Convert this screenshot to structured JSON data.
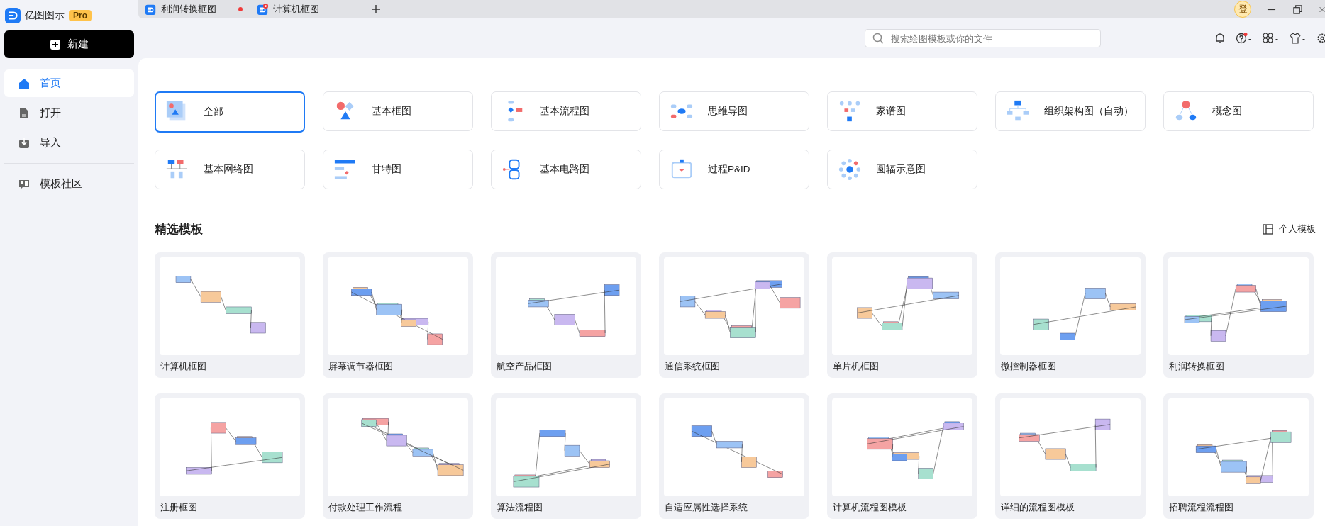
{
  "app": {
    "name": "亿图图示",
    "badge": "Pro"
  },
  "tabs": [
    {
      "title": "利润转换框图",
      "unsaved": true,
      "icon_badge": false
    },
    {
      "title": "计算机框图",
      "unsaved": false,
      "icon_badge": true
    }
  ],
  "user": {
    "avatar": "登"
  },
  "new_button": "新建",
  "sidebar": {
    "items": [
      {
        "label": "首页",
        "selected": true
      },
      {
        "label": "打开",
        "selected": false
      },
      {
        "label": "导入",
        "selected": false
      }
    ],
    "community": {
      "label": "模板社区",
      "selected": false
    }
  },
  "search": {
    "placeholder": "搜索绘图模板或你的文件"
  },
  "toolbar": {
    "help_badge": true
  },
  "categories": [
    {
      "label": "全部",
      "selected": true
    },
    {
      "label": "基本框图",
      "selected": false
    },
    {
      "label": "基本流程图",
      "selected": false
    },
    {
      "label": "思维导图",
      "selected": false
    },
    {
      "label": "家谱图",
      "selected": false
    },
    {
      "label": "组织架构图（自动）",
      "selected": false
    },
    {
      "label": "概念图",
      "selected": false
    },
    {
      "label": "基本网络图",
      "selected": false
    },
    {
      "label": "甘特图",
      "selected": false
    },
    {
      "label": "基本电路图",
      "selected": false
    },
    {
      "label": "过程P&ID",
      "selected": false
    },
    {
      "label": "圆辐示意图",
      "selected": false
    }
  ],
  "featured": {
    "title": "精选模板",
    "personal_link": "个人模板",
    "templates": [
      {
        "title": "计算机框图"
      },
      {
        "title": "屏幕调节器框图"
      },
      {
        "title": "航空产品框图"
      },
      {
        "title": "通信系统框图"
      },
      {
        "title": "单片机框图"
      },
      {
        "title": "微控制器框图"
      },
      {
        "title": "利润转换框图"
      },
      {
        "title": "注册框图"
      },
      {
        "title": "付款处理工作流程"
      },
      {
        "title": "算法流程图"
      },
      {
        "title": "自适应属性选择系统"
      },
      {
        "title": "计算机流程图模板"
      },
      {
        "title": "详细的流程图模板"
      },
      {
        "title": "招聘流程流程图"
      }
    ]
  }
}
